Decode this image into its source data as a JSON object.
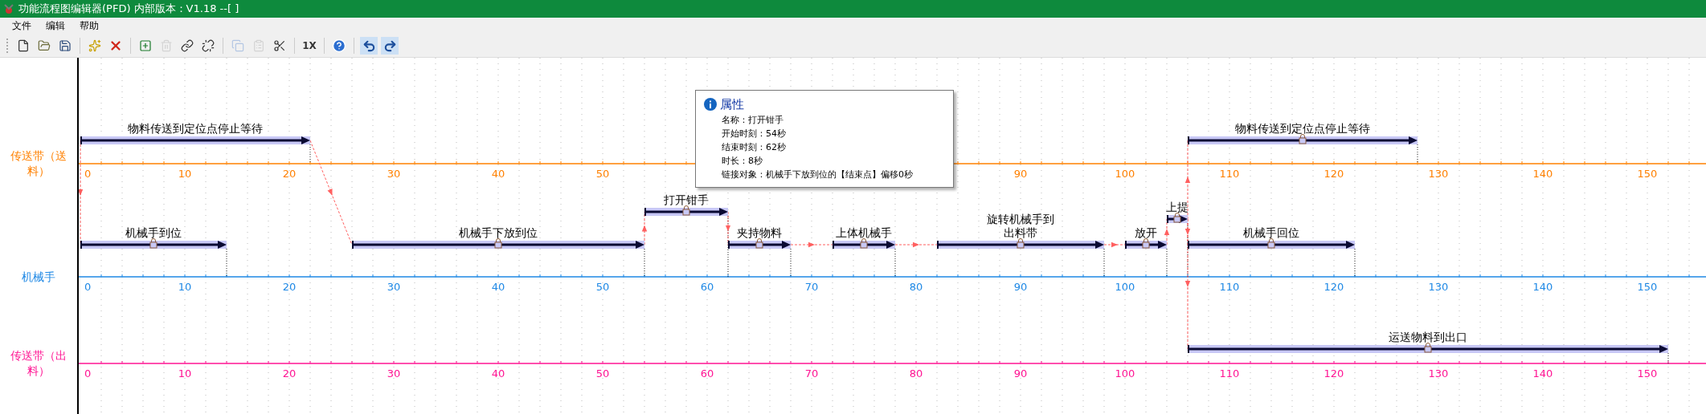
{
  "window": {
    "title": "功能流程图编辑器(PFD) 内部版本：V1.18 --[ ]"
  },
  "menu": [
    "文件",
    "编辑",
    "帮助"
  ],
  "toolbar": [
    {
      "kind": "new",
      "disabled": false
    },
    {
      "kind": "open",
      "disabled": false
    },
    {
      "kind": "save",
      "disabled": false
    },
    {
      "kind": "sep"
    },
    {
      "kind": "node",
      "disabled": false
    },
    {
      "kind": "delete",
      "disabled": false
    },
    {
      "kind": "sep"
    },
    {
      "kind": "add",
      "disabled": false
    },
    {
      "kind": "trash",
      "disabled": true
    },
    {
      "kind": "link",
      "disabled": false
    },
    {
      "kind": "unlink",
      "disabled": false
    },
    {
      "kind": "sep"
    },
    {
      "kind": "copy",
      "disabled": true
    },
    {
      "kind": "paste",
      "disabled": true
    },
    {
      "kind": "cut",
      "disabled": false
    },
    {
      "kind": "sep"
    },
    {
      "kind": "zoom",
      "text": "1X",
      "disabled": false
    },
    {
      "kind": "sep"
    },
    {
      "kind": "help",
      "disabled": false
    },
    {
      "kind": "sep"
    },
    {
      "kind": "undo",
      "disabled": false
    },
    {
      "kind": "redo",
      "disabled": false
    }
  ],
  "tracks": [
    {
      "name": "传送带（送料）",
      "color": "#ff8000",
      "ticks": [
        "0",
        "10",
        "20",
        "30",
        "40",
        "50",
        "90",
        "100",
        "110",
        "120",
        "130",
        "140",
        "150"
      ],
      "tasks": [
        {
          "lines": [
            "物料传送到定位点停止等待"
          ],
          "locked": false
        },
        {
          "lines": [
            "物料传送到定位点停止等待"
          ],
          "locked": true
        }
      ]
    },
    {
      "name": "机械手",
      "color": "#1e88e5",
      "ticks": [
        "0",
        "10",
        "20",
        "30",
        "40",
        "50",
        "60",
        "70",
        "80",
        "90",
        "100",
        "110",
        "120",
        "130",
        "140",
        "150"
      ],
      "tasks": [
        {
          "lines": [
            "机械手到位"
          ],
          "locked": true
        },
        {
          "lines": [
            "机械手下放到位"
          ],
          "locked": true
        },
        {
          "lines": [
            "打开钳手"
          ],
          "locked": true
        },
        {
          "lines": [
            "夹持物料"
          ],
          "locked": true
        },
        {
          "lines": [
            "上体机械手"
          ],
          "locked": true
        },
        {
          "lines": [
            "旋转机械手到",
            "出料带"
          ],
          "locked": true
        },
        {
          "lines": [
            "放开"
          ],
          "locked": true
        },
        {
          "lines": [
            "上提"
          ],
          "locked": true
        },
        {
          "lines": [
            "机械手回位"
          ],
          "locked": true
        }
      ]
    },
    {
      "name": "传送带（出料）",
      "color": "#ff1493",
      "ticks": [
        "0",
        "10",
        "20",
        "30",
        "40",
        "50",
        "60",
        "70",
        "80",
        "90",
        "100",
        "110",
        "120",
        "130",
        "140",
        "150"
      ],
      "tasks": [
        {
          "lines": [
            "运送物料到出口"
          ],
          "locked": true
        }
      ]
    }
  ],
  "tooltip": {
    "title": "属性",
    "lines": [
      "名称：打开钳手",
      "开始时刻：54秒",
      "结束时刻：62秒",
      "时长：8秒",
      "链接对象：机械手下放到位的【结束点】偏移0秒"
    ]
  }
}
